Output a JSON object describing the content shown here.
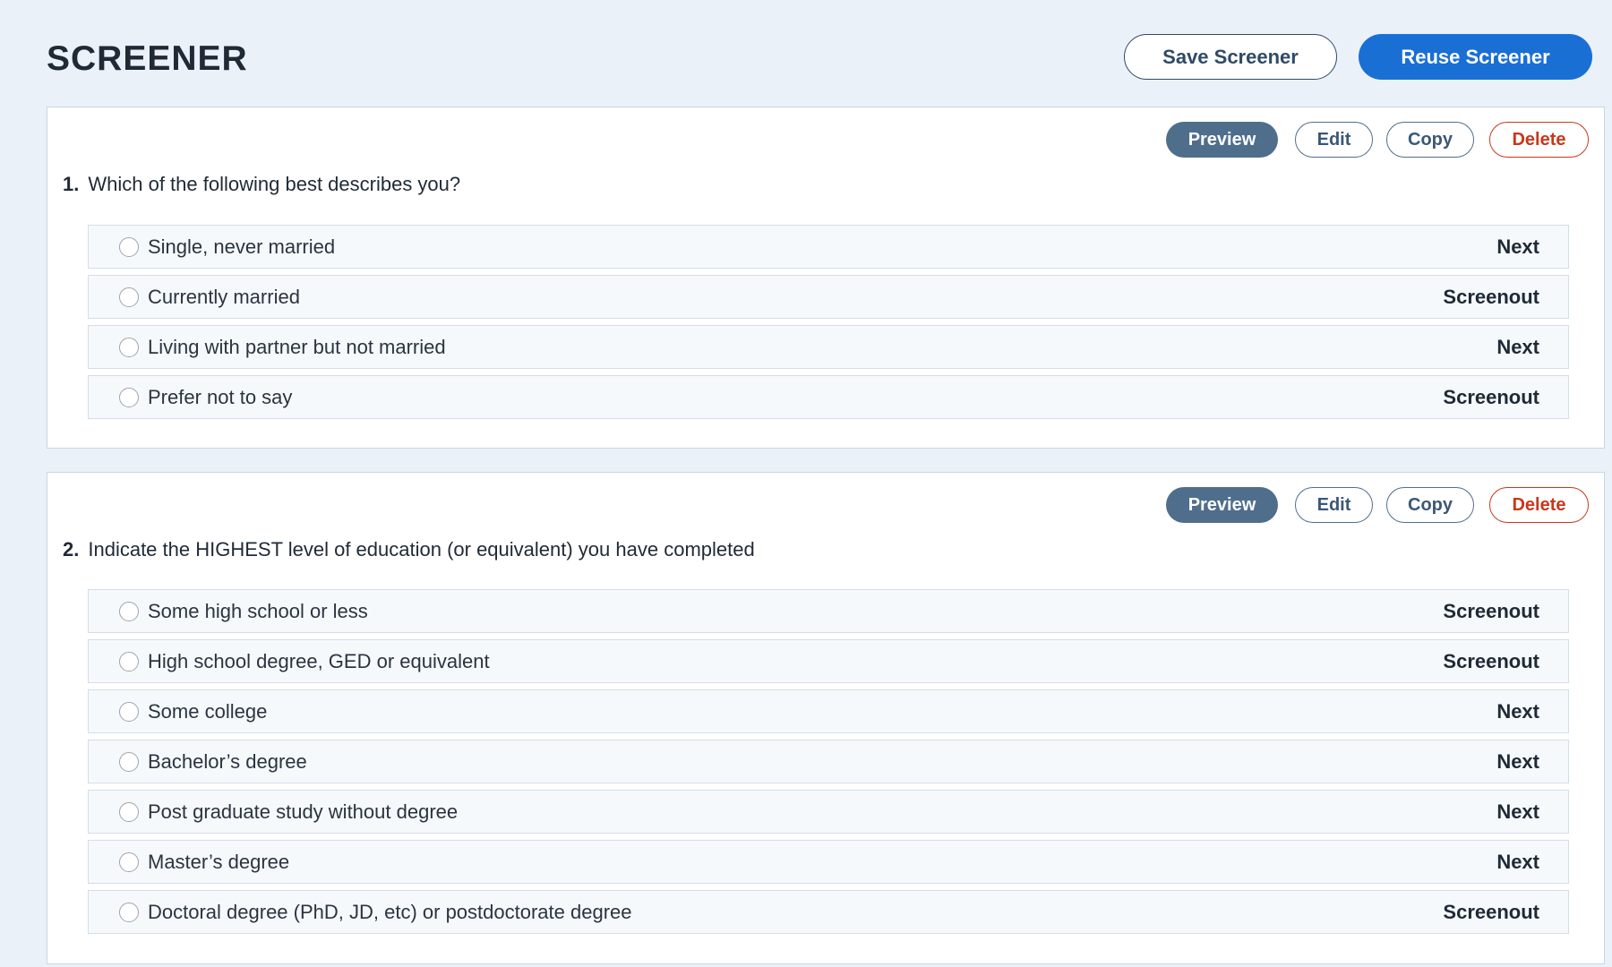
{
  "page": {
    "title": "SCREENER",
    "save_label": "Save Screener",
    "reuse_label": "Reuse Screener"
  },
  "actions": {
    "preview": "Preview",
    "edit": "Edit",
    "copy": "Copy",
    "delete": "Delete"
  },
  "colors": {
    "background": "#ebf1f9",
    "primary": "#1a6fd4",
    "preview": "#4f6e8c",
    "danger": "#c8381c"
  },
  "questions": [
    {
      "number": "1.",
      "text": "Which of the following best describes you?",
      "options": [
        {
          "label": "Single, never married",
          "action": "Next"
        },
        {
          "label": "Currently married",
          "action": "Screenout"
        },
        {
          "label": "Living with partner but not married",
          "action": "Next"
        },
        {
          "label": "Prefer not to say",
          "action": "Screenout"
        }
      ]
    },
    {
      "number": "2.",
      "text": "Indicate the HIGHEST level of education (or equivalent) you have completed",
      "options": [
        {
          "label": "Some high school or less",
          "action": "Screenout"
        },
        {
          "label": "High school degree, GED or equivalent",
          "action": "Screenout"
        },
        {
          "label": "Some college",
          "action": "Next"
        },
        {
          "label": "Bachelor’s degree",
          "action": "Next"
        },
        {
          "label": "Post graduate study without degree",
          "action": "Next"
        },
        {
          "label": "Master’s degree",
          "action": "Next"
        },
        {
          "label": "Doctoral degree (PhD, JD, etc) or postdoctorate degree",
          "action": "Screenout"
        }
      ]
    }
  ]
}
